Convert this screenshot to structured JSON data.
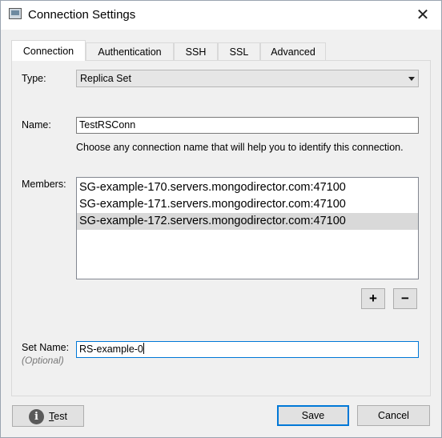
{
  "window": {
    "title": "Connection Settings",
    "close_glyph": "✕"
  },
  "tabs": [
    {
      "label": "Connection",
      "active": true
    },
    {
      "label": "Authentication",
      "active": false
    },
    {
      "label": "SSH",
      "active": false
    },
    {
      "label": "SSL",
      "active": false
    },
    {
      "label": "Advanced",
      "active": false
    }
  ],
  "connection": {
    "type_label": "Type:",
    "type_value": "Replica Set",
    "name_label": "Name:",
    "name_value": "TestRSConn",
    "name_hint": "Choose any connection name that will help you to identify this connection.",
    "members_label": "Members:",
    "members": [
      "SG-example-170.servers.mongodirector.com:47100",
      "SG-example-171.servers.mongodirector.com:47100",
      "SG-example-172.servers.mongodirector.com:47100"
    ],
    "selected_member_index": 2,
    "add_glyph": "+",
    "remove_glyph": "−",
    "setname_label": "Set Name:",
    "setname_sublabel": "(Optional)",
    "setname_value": "RS-example-0"
  },
  "footer": {
    "test_label_first": "T",
    "test_label_rest": "est",
    "info_glyph": "i",
    "save_label": "Save",
    "cancel_label": "Cancel"
  }
}
